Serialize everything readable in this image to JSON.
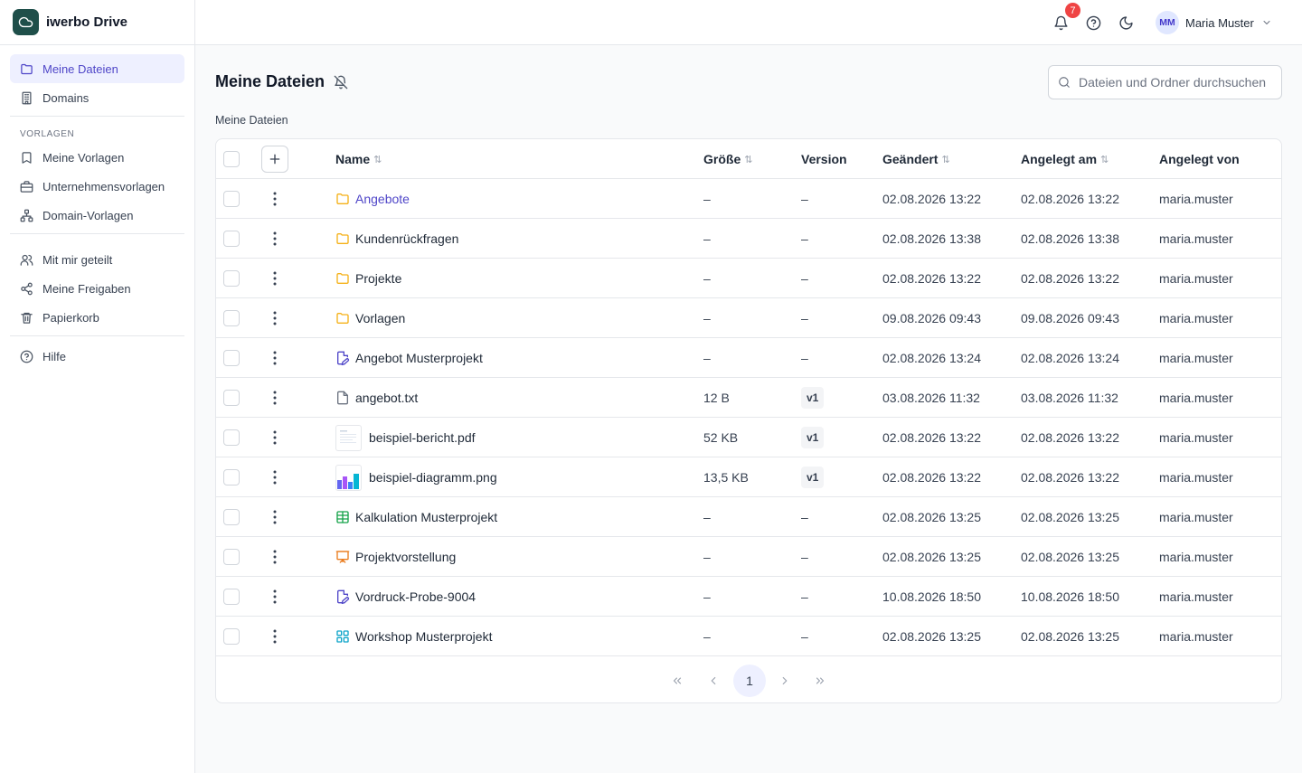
{
  "app": {
    "name": "iwerbo Drive"
  },
  "sidebar": {
    "items_main": [
      {
        "label": "Meine Dateien",
        "icon": "folder-icon",
        "active": true
      },
      {
        "label": "Domains",
        "icon": "building-icon",
        "active": false
      }
    ],
    "section_label": "VORLAGEN",
    "items_templates": [
      {
        "label": "Meine Vorlagen",
        "icon": "bookmark-icon"
      },
      {
        "label": "Unternehmensvorlagen",
        "icon": "briefcase-icon"
      },
      {
        "label": "Domain-Vorlagen",
        "icon": "sitemap-icon"
      }
    ],
    "items_shared": [
      {
        "label": "Mit mir geteilt",
        "icon": "users-icon"
      },
      {
        "label": "Meine Freigaben",
        "icon": "share-icon"
      },
      {
        "label": "Papierkorb",
        "icon": "trash-icon"
      }
    ],
    "items_help": [
      {
        "label": "Hilfe",
        "icon": "help-icon"
      }
    ]
  },
  "topbar": {
    "notification_count": "7",
    "user_initials": "MM",
    "user_name": "Maria Muster"
  },
  "main": {
    "title": "Meine Dateien",
    "breadcrumb": "Meine Dateien",
    "search_placeholder": "Dateien und Ordner durchsuchen"
  },
  "table": {
    "columns": {
      "name": "Name",
      "size": "Größe",
      "version": "Version",
      "changed": "Geändert",
      "created": "Angelegt am",
      "creator": "Angelegt von"
    },
    "rows": [
      {
        "name": "Angebote",
        "kind": "folder",
        "size": "–",
        "version": "–",
        "changed": "02.08.2026 13:22",
        "created": "02.08.2026 13:22",
        "creator": "maria.muster"
      },
      {
        "name": "Kundenrückfragen",
        "kind": "folder",
        "size": "–",
        "version": "–",
        "changed": "02.08.2026 13:38",
        "created": "02.08.2026 13:38",
        "creator": "maria.muster"
      },
      {
        "name": "Projekte",
        "kind": "folder",
        "size": "–",
        "version": "–",
        "changed": "02.08.2026 13:22",
        "created": "02.08.2026 13:22",
        "creator": "maria.muster"
      },
      {
        "name": "Vorlagen",
        "kind": "folder",
        "size": "–",
        "version": "–",
        "changed": "09.08.2026 09:43",
        "created": "09.08.2026 09:43",
        "creator": "maria.muster"
      },
      {
        "name": "Angebot Musterprojekt",
        "kind": "form",
        "size": "–",
        "version": "–",
        "changed": "02.08.2026 13:24",
        "created": "02.08.2026 13:24",
        "creator": "maria.muster"
      },
      {
        "name": "angebot.txt",
        "kind": "text",
        "size": "12 B",
        "version": "v1",
        "changed": "03.08.2026 11:32",
        "created": "03.08.2026 11:32",
        "creator": "maria.muster"
      },
      {
        "name": "beispiel-bericht.pdf",
        "kind": "pdf",
        "size": "52 KB",
        "version": "v1",
        "changed": "02.08.2026 13:22",
        "created": "02.08.2026 13:22",
        "creator": "maria.muster"
      },
      {
        "name": "beispiel-diagramm.png",
        "kind": "image",
        "size": "13,5 KB",
        "version": "v1",
        "changed": "02.08.2026 13:22",
        "created": "02.08.2026 13:22",
        "creator": "maria.muster"
      },
      {
        "name": "Kalkulation Musterprojekt",
        "kind": "spreadsheet",
        "size": "–",
        "version": "–",
        "changed": "02.08.2026 13:25",
        "created": "02.08.2026 13:25",
        "creator": "maria.muster"
      },
      {
        "name": "Projektvorstellung",
        "kind": "presentation",
        "size": "–",
        "version": "–",
        "changed": "02.08.2026 13:25",
        "created": "02.08.2026 13:25",
        "creator": "maria.muster"
      },
      {
        "name": "Vordruck-Probe-9004",
        "kind": "form",
        "size": "–",
        "version": "–",
        "changed": "10.08.2026 18:50",
        "created": "10.08.2026 18:50",
        "creator": "maria.muster"
      },
      {
        "name": "Workshop Musterprojekt",
        "kind": "board",
        "size": "–",
        "version": "–",
        "changed": "02.08.2026 13:25",
        "created": "02.08.2026 13:25",
        "creator": "maria.muster"
      }
    ]
  },
  "pagination": {
    "current_page": "1"
  },
  "colors": {
    "accent": "#4f46c8",
    "brand": "#1f4f4a",
    "folder": "#f5b118",
    "spreadsheet": "#16a34a",
    "presentation": "#ea7c1e",
    "board": "#0ea5c9",
    "badge": "#ef4444"
  }
}
